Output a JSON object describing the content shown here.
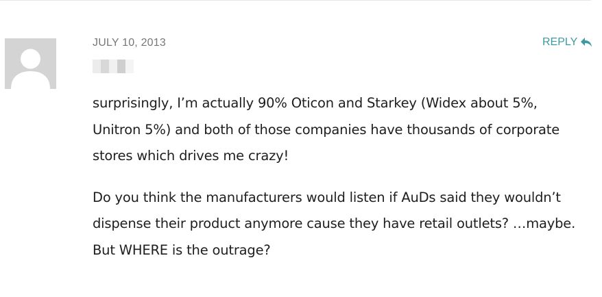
{
  "comment": {
    "date": "JULY 10, 2013",
    "reply_label": "REPLY",
    "paragraphs": [
      "surprisingly, I’m actually 90% Oticon and Starkey (Widex about 5%, Unitron 5%) and both of those companies have thousands of corporate stores which drives me crazy!",
      "Do you think the manufacturers would listen if AuDs said they wouldn’t dispense their product anymore cause they have retail outlets? …maybe. But WHERE is the outrage?"
    ]
  },
  "icons": {
    "avatar": "default-avatar-icon",
    "reply": "reply-arrow-icon"
  },
  "colors": {
    "accent": "#3d9aa1",
    "date": "#777777",
    "text": "#1e1e1e",
    "avatar_bg": "#d4d4d4"
  }
}
